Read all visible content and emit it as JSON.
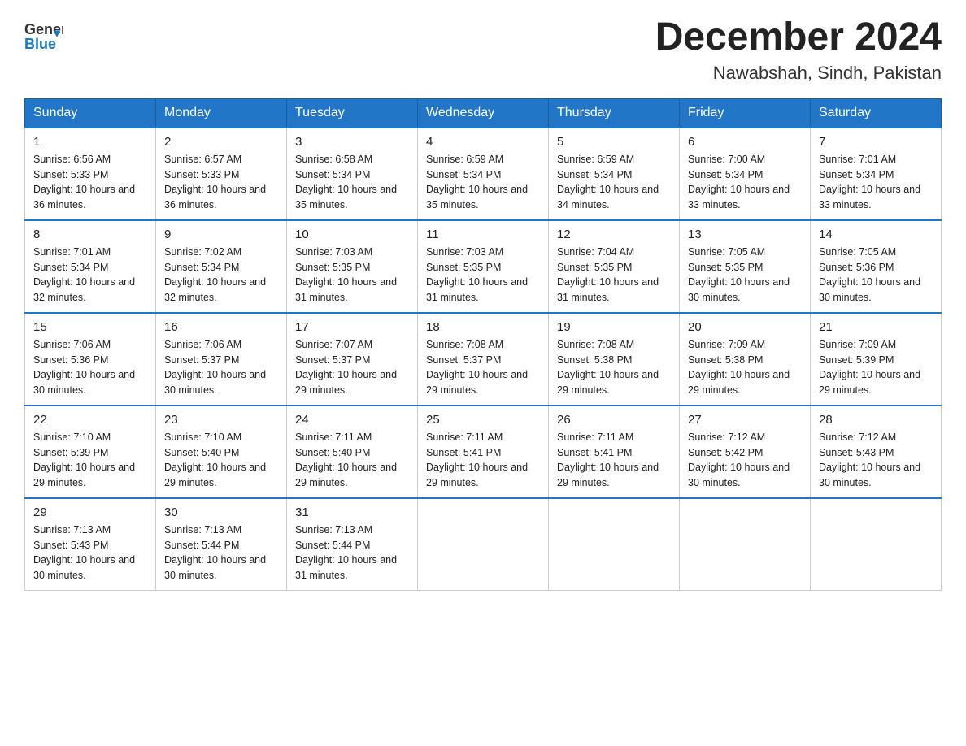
{
  "header": {
    "logo_general": "General",
    "logo_blue": "Blue",
    "month": "December 2024",
    "location": "Nawabshah, Sindh, Pakistan"
  },
  "weekdays": [
    "Sunday",
    "Monday",
    "Tuesday",
    "Wednesday",
    "Thursday",
    "Friday",
    "Saturday"
  ],
  "weeks": [
    [
      {
        "day": "1",
        "sunrise": "Sunrise: 6:56 AM",
        "sunset": "Sunset: 5:33 PM",
        "daylight": "Daylight: 10 hours and 36 minutes."
      },
      {
        "day": "2",
        "sunrise": "Sunrise: 6:57 AM",
        "sunset": "Sunset: 5:33 PM",
        "daylight": "Daylight: 10 hours and 36 minutes."
      },
      {
        "day": "3",
        "sunrise": "Sunrise: 6:58 AM",
        "sunset": "Sunset: 5:34 PM",
        "daylight": "Daylight: 10 hours and 35 minutes."
      },
      {
        "day": "4",
        "sunrise": "Sunrise: 6:59 AM",
        "sunset": "Sunset: 5:34 PM",
        "daylight": "Daylight: 10 hours and 35 minutes."
      },
      {
        "day": "5",
        "sunrise": "Sunrise: 6:59 AM",
        "sunset": "Sunset: 5:34 PM",
        "daylight": "Daylight: 10 hours and 34 minutes."
      },
      {
        "day": "6",
        "sunrise": "Sunrise: 7:00 AM",
        "sunset": "Sunset: 5:34 PM",
        "daylight": "Daylight: 10 hours and 33 minutes."
      },
      {
        "day": "7",
        "sunrise": "Sunrise: 7:01 AM",
        "sunset": "Sunset: 5:34 PM",
        "daylight": "Daylight: 10 hours and 33 minutes."
      }
    ],
    [
      {
        "day": "8",
        "sunrise": "Sunrise: 7:01 AM",
        "sunset": "Sunset: 5:34 PM",
        "daylight": "Daylight: 10 hours and 32 minutes."
      },
      {
        "day": "9",
        "sunrise": "Sunrise: 7:02 AM",
        "sunset": "Sunset: 5:34 PM",
        "daylight": "Daylight: 10 hours and 32 minutes."
      },
      {
        "day": "10",
        "sunrise": "Sunrise: 7:03 AM",
        "sunset": "Sunset: 5:35 PM",
        "daylight": "Daylight: 10 hours and 31 minutes."
      },
      {
        "day": "11",
        "sunrise": "Sunrise: 7:03 AM",
        "sunset": "Sunset: 5:35 PM",
        "daylight": "Daylight: 10 hours and 31 minutes."
      },
      {
        "day": "12",
        "sunrise": "Sunrise: 7:04 AM",
        "sunset": "Sunset: 5:35 PM",
        "daylight": "Daylight: 10 hours and 31 minutes."
      },
      {
        "day": "13",
        "sunrise": "Sunrise: 7:05 AM",
        "sunset": "Sunset: 5:35 PM",
        "daylight": "Daylight: 10 hours and 30 minutes."
      },
      {
        "day": "14",
        "sunrise": "Sunrise: 7:05 AM",
        "sunset": "Sunset: 5:36 PM",
        "daylight": "Daylight: 10 hours and 30 minutes."
      }
    ],
    [
      {
        "day": "15",
        "sunrise": "Sunrise: 7:06 AM",
        "sunset": "Sunset: 5:36 PM",
        "daylight": "Daylight: 10 hours and 30 minutes."
      },
      {
        "day": "16",
        "sunrise": "Sunrise: 7:06 AM",
        "sunset": "Sunset: 5:37 PM",
        "daylight": "Daylight: 10 hours and 30 minutes."
      },
      {
        "day": "17",
        "sunrise": "Sunrise: 7:07 AM",
        "sunset": "Sunset: 5:37 PM",
        "daylight": "Daylight: 10 hours and 29 minutes."
      },
      {
        "day": "18",
        "sunrise": "Sunrise: 7:08 AM",
        "sunset": "Sunset: 5:37 PM",
        "daylight": "Daylight: 10 hours and 29 minutes."
      },
      {
        "day": "19",
        "sunrise": "Sunrise: 7:08 AM",
        "sunset": "Sunset: 5:38 PM",
        "daylight": "Daylight: 10 hours and 29 minutes."
      },
      {
        "day": "20",
        "sunrise": "Sunrise: 7:09 AM",
        "sunset": "Sunset: 5:38 PM",
        "daylight": "Daylight: 10 hours and 29 minutes."
      },
      {
        "day": "21",
        "sunrise": "Sunrise: 7:09 AM",
        "sunset": "Sunset: 5:39 PM",
        "daylight": "Daylight: 10 hours and 29 minutes."
      }
    ],
    [
      {
        "day": "22",
        "sunrise": "Sunrise: 7:10 AM",
        "sunset": "Sunset: 5:39 PM",
        "daylight": "Daylight: 10 hours and 29 minutes."
      },
      {
        "day": "23",
        "sunrise": "Sunrise: 7:10 AM",
        "sunset": "Sunset: 5:40 PM",
        "daylight": "Daylight: 10 hours and 29 minutes."
      },
      {
        "day": "24",
        "sunrise": "Sunrise: 7:11 AM",
        "sunset": "Sunset: 5:40 PM",
        "daylight": "Daylight: 10 hours and 29 minutes."
      },
      {
        "day": "25",
        "sunrise": "Sunrise: 7:11 AM",
        "sunset": "Sunset: 5:41 PM",
        "daylight": "Daylight: 10 hours and 29 minutes."
      },
      {
        "day": "26",
        "sunrise": "Sunrise: 7:11 AM",
        "sunset": "Sunset: 5:41 PM",
        "daylight": "Daylight: 10 hours and 29 minutes."
      },
      {
        "day": "27",
        "sunrise": "Sunrise: 7:12 AM",
        "sunset": "Sunset: 5:42 PM",
        "daylight": "Daylight: 10 hours and 30 minutes."
      },
      {
        "day": "28",
        "sunrise": "Sunrise: 7:12 AM",
        "sunset": "Sunset: 5:43 PM",
        "daylight": "Daylight: 10 hours and 30 minutes."
      }
    ],
    [
      {
        "day": "29",
        "sunrise": "Sunrise: 7:13 AM",
        "sunset": "Sunset: 5:43 PM",
        "daylight": "Daylight: 10 hours and 30 minutes."
      },
      {
        "day": "30",
        "sunrise": "Sunrise: 7:13 AM",
        "sunset": "Sunset: 5:44 PM",
        "daylight": "Daylight: 10 hours and 30 minutes."
      },
      {
        "day": "31",
        "sunrise": "Sunrise: 7:13 AM",
        "sunset": "Sunset: 5:44 PM",
        "daylight": "Daylight: 10 hours and 31 minutes."
      },
      null,
      null,
      null,
      null
    ]
  ]
}
